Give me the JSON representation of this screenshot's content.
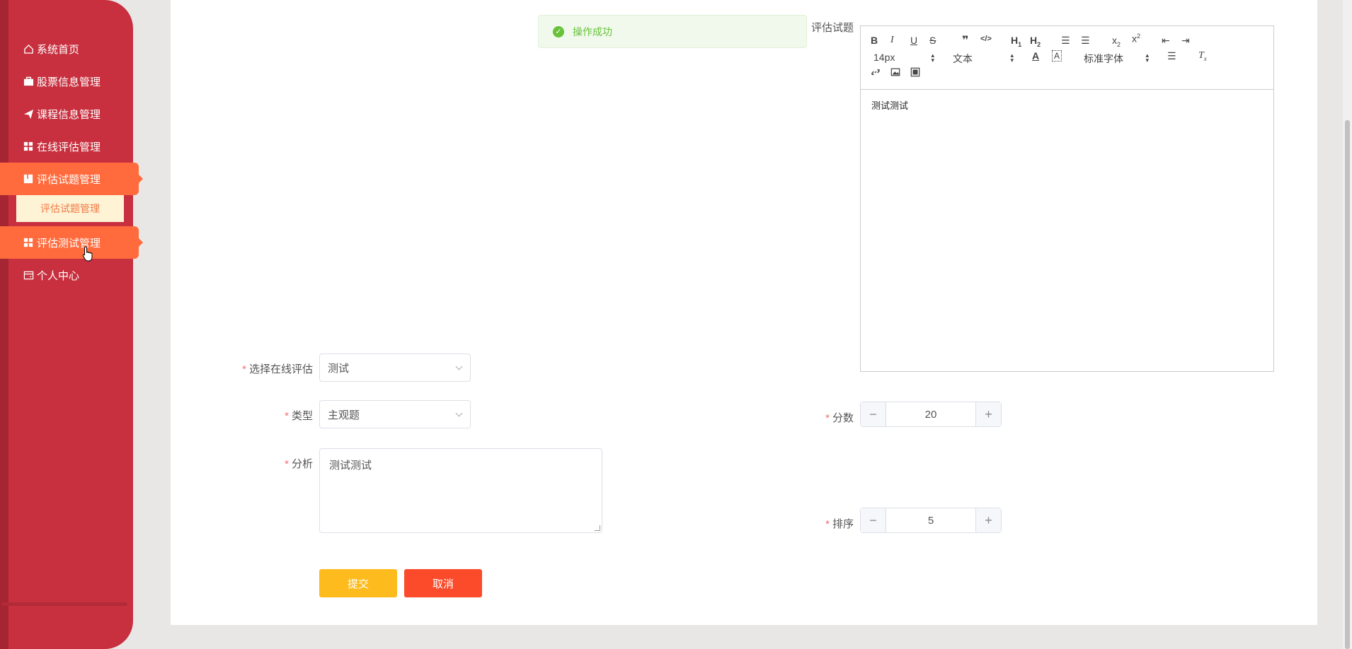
{
  "sidebar": {
    "items": [
      {
        "label": "系统首页",
        "icon": "home-icon"
      },
      {
        "label": "股票信息管理",
        "icon": "briefcase-icon"
      },
      {
        "label": "课程信息管理",
        "icon": "paper-plane-icon"
      },
      {
        "label": "在线评估管理",
        "icon": "grid-icon"
      },
      {
        "label": "评估试题管理",
        "icon": "book-icon"
      },
      {
        "label": "评估测试管理",
        "icon": "grid-icon"
      },
      {
        "label": "个人中心",
        "icon": "wallet-icon"
      }
    ],
    "submenu_label": "评估试题管理",
    "colors": {
      "bg": "#c8303f",
      "active": "#ff6b3d",
      "submenu_bg": "#fff3d6"
    }
  },
  "toast": {
    "message": "操作成功",
    "color": "#67c23a"
  },
  "form": {
    "question_label": "评估试题",
    "editor": {
      "font_size": "14px",
      "header_select": "文本",
      "font_family": "标准字体",
      "content": "测试测试"
    },
    "assessment_label": "选择在线评估",
    "assessment_value": "测试",
    "type_label": "类型",
    "type_value": "主观题",
    "analysis_label": "分析",
    "analysis_value": "测试测试",
    "score_label": "分数",
    "score_value": "20",
    "order_label": "排序",
    "order_value": "5",
    "required_mark": "*",
    "submit_label": "提交",
    "cancel_label": "取消",
    "colors": {
      "submit": "#fdbb1d",
      "cancel": "#fb4b2a"
    }
  }
}
